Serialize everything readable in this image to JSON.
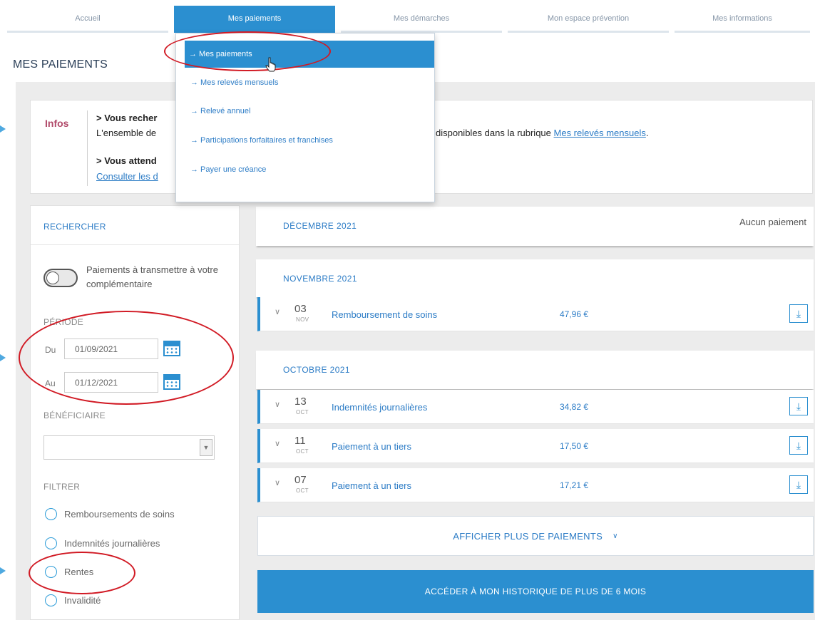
{
  "topnav": [
    {
      "label": "Accueil",
      "width": 226
    },
    {
      "label": "Mes paiements",
      "width": 226,
      "active": true
    },
    {
      "label": "Mes démarches",
      "width": 226
    },
    {
      "label": "Mon espace prévention",
      "width": 226
    },
    {
      "label": "Mes informations",
      "width": 190
    }
  ],
  "page_title": "MES PAIEMENTS",
  "dropdown": {
    "items": [
      "→ Mes paiements",
      "→ Mes relevés mensuels",
      "→ Relevé annuel",
      "→ Participations forfaitaires et franchises",
      "→ Payer une créance"
    ]
  },
  "infos": {
    "label": "Infos",
    "line1_bold": "> Vous recher",
    "line2_start": "L'ensemble de",
    "line2_end": "disponibles dans la rubrique",
    "line2_link": "Mes relevés mensuels",
    "line2_dot": ".",
    "line3_bold": "> Vous attend",
    "line4_link": "Consulter les d"
  },
  "search": {
    "title": "RECHERCHER",
    "toggle_label": "Paiements à transmettre à votre complémentaire",
    "periode_label": "PÉRIODE",
    "du_label": "Du",
    "du_value": "01/09/2021",
    "au_label": "Au",
    "au_value": "01/12/2021",
    "beneficiaire_label": "BÉNÉFICIAIRE",
    "filtrer_label": "FILTRER",
    "filters": [
      "Remboursements de soins",
      "Indemnités journalières",
      "Rentes",
      "Invalidité"
    ]
  },
  "months": {
    "december": {
      "title": "DÉCEMBRE 2021",
      "none": "Aucun paiement"
    },
    "november": {
      "title": "NOVEMBRE 2021"
    },
    "october": {
      "title": "OCTOBRE 2021"
    }
  },
  "payments": [
    {
      "day": "03",
      "month": "NOV",
      "desc": "Remboursement de soins",
      "amount": "47,96 €"
    },
    {
      "day": "13",
      "month": "OCT",
      "desc": "Indemnités journalières",
      "amount": "34,82 €"
    },
    {
      "day": "11",
      "month": "OCT",
      "desc": "Paiement à un tiers",
      "amount": "17,50 €"
    },
    {
      "day": "07",
      "month": "OCT",
      "desc": "Paiement à un tiers",
      "amount": "17,21 €"
    }
  ],
  "more_label": "AFFICHER PLUS DE PAIEMENTS",
  "history_label": "ACCÉDER À MON HISTORIQUE DE PLUS DE 6 MOIS",
  "colors": {
    "primary": "#2b8fd0",
    "annotation": "#d11a24",
    "infos_label": "#b14a6a"
  }
}
